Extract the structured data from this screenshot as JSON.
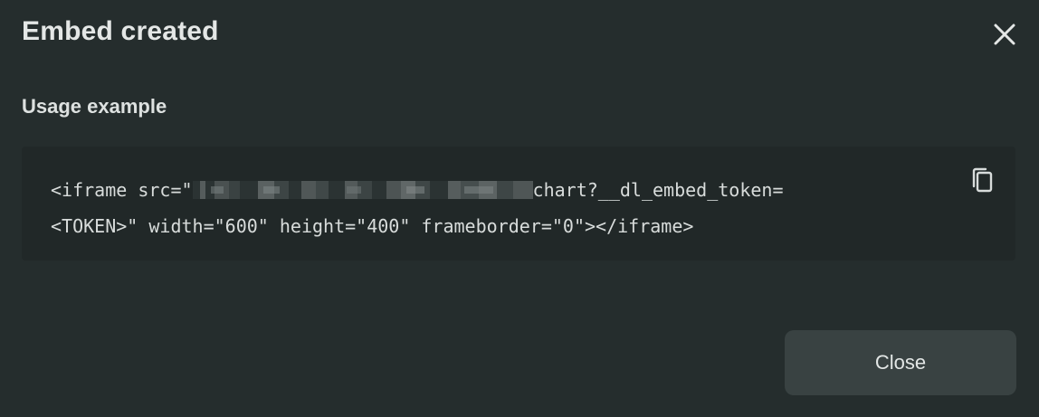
{
  "dialog": {
    "title": "Embed created",
    "close_icon": "close-icon"
  },
  "usage": {
    "label": "Usage example",
    "code_line1_prefix": "<iframe src=\"",
    "code_line1_suffix": "chart?__dl_embed_token=",
    "code_line2": "<TOKEN>\" width=\"600\" height=\"400\" frameborder=\"0\"></iframe>",
    "copy_icon": "copy-icon"
  },
  "footer": {
    "close_label": "Close"
  },
  "colors": {
    "background": "#252d2d",
    "code_background": "#212828",
    "button_background": "#394242",
    "text": "#e4e7e6"
  }
}
